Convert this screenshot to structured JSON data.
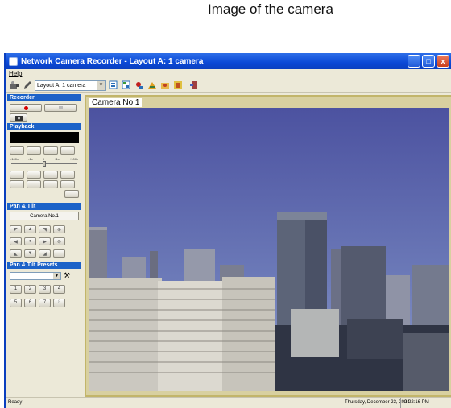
{
  "callout": {
    "label": "Image of the camera"
  },
  "window": {
    "title": "Network Camera Recorder - Layout A: 1 camera",
    "controls": {
      "minimize": "_",
      "maximize": "□",
      "close": "x"
    }
  },
  "menubar": {
    "items": [
      "Help"
    ]
  },
  "toolbar": {
    "layout_select_value": "Layout A: 1 camera",
    "icons": [
      "camera-settings-icon",
      "edit-icon",
      "layout-a-icon",
      "layout-b-icon",
      "pan-tilt-icon",
      "tools-icon",
      "folder-icon",
      "schedule-icon",
      "exit-icon"
    ]
  },
  "panel": {
    "recorder": {
      "title": "Recorder"
    },
    "playback": {
      "title": "Playback",
      "speed_scale": [
        "-100x",
        "-1x",
        "0",
        "+1x",
        "+100x"
      ]
    },
    "pan_tilt": {
      "title": "Pan & Tilt",
      "camera_name": "Camera No.1"
    },
    "presets": {
      "title": "Pan & Tilt Presets",
      "buttons": [
        "1",
        "2",
        "3",
        "4",
        "5",
        "6",
        "7",
        "8"
      ]
    }
  },
  "video": {
    "camera_label": "Camera No.1"
  },
  "statusbar": {
    "status": "Ready",
    "date": "Thursday, December 23, 2004",
    "time": "2:22:16 PM"
  },
  "colors": {
    "accent_red": "#d0021b",
    "title_blue": "#0a48d6",
    "section_blue": "#1c62c8"
  }
}
